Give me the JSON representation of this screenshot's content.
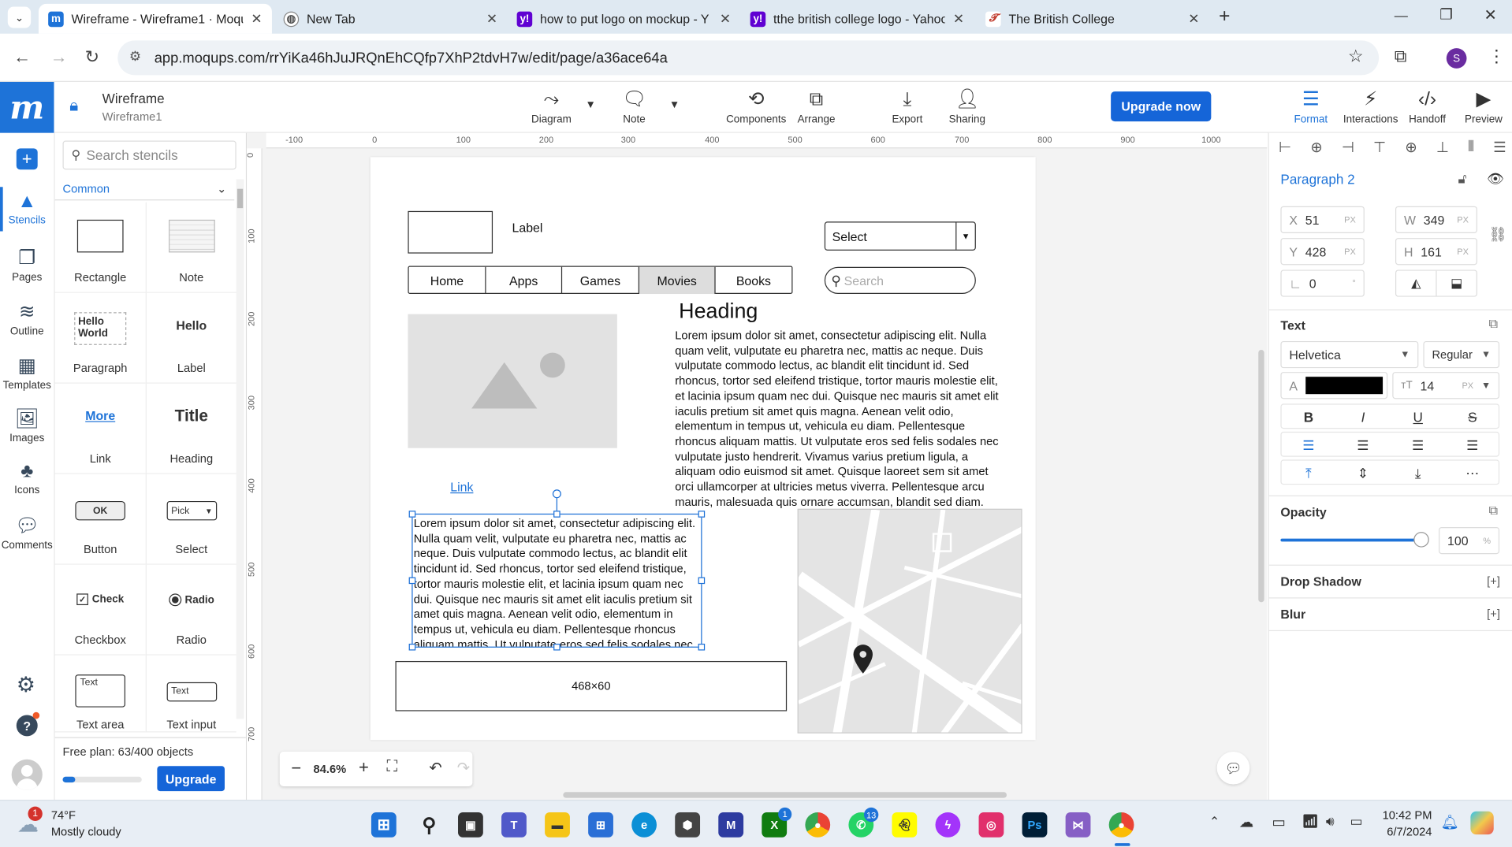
{
  "browser": {
    "tabs": [
      {
        "title": "Wireframe - Wireframe1 · Moqu",
        "active": true
      },
      {
        "title": "New Tab"
      },
      {
        "title": "how to put logo on mockup - Y"
      },
      {
        "title": "tthe british college logo - Yahoo"
      },
      {
        "title": "The British College"
      }
    ],
    "url": "app.moqups.com/rrYiKa46hJuJRQnEhCQfp7XhP2tdvH7w/edit/page/a36ace64a",
    "profile_initial": "S"
  },
  "app": {
    "logo": "m",
    "doc_title": "Wireframe",
    "doc_subtitle": "Wireframe1",
    "toolbar": [
      "Diagram",
      "Note",
      "Components",
      "Arrange",
      "Export",
      "Sharing"
    ],
    "upgrade_now": "Upgrade now",
    "right_tools": [
      "Format",
      "Interactions",
      "Handoff",
      "Preview"
    ]
  },
  "rail": [
    "Stencils",
    "Pages",
    "Outline",
    "Templates",
    "Images",
    "Icons",
    "Comments"
  ],
  "stencils": {
    "search_placeholder": "Search stencils",
    "category": "Common",
    "items": [
      "Rectangle",
      "Note",
      "Paragraph",
      "Label",
      "Link",
      "Heading",
      "Button",
      "Select",
      "Checkbox",
      "Radio",
      "Text area",
      "Text input"
    ],
    "preview_text": {
      "paragraph": "Hello World",
      "label": "Hello",
      "link": "More",
      "heading": "Title",
      "button": "OK",
      "select": "Pick",
      "checkbox": "Check",
      "radio": "Radio",
      "textarea": "Text",
      "textinput": "Text"
    },
    "plan_text": "Free plan: 63/400 objects",
    "plan_fraction": 0.1575,
    "upgrade": "Upgrade"
  },
  "ruler": {
    "h": [
      "-100",
      "0",
      "100",
      "200",
      "300",
      "400",
      "500",
      "600",
      "700",
      "800",
      "900",
      "1000"
    ],
    "v": [
      "0",
      "100",
      "200",
      "300",
      "400",
      "500",
      "600",
      "700"
    ]
  },
  "canvas": {
    "label": "Label",
    "select": "Select",
    "nav": [
      "Home",
      "Apps",
      "Games",
      "Movies",
      "Books"
    ],
    "search_placeholder": "Search",
    "heading": "Heading",
    "link": "Link",
    "paragraph_right": "Lorem ipsum dolor sit amet, consectetur adipiscing elit. Nulla quam velit, vulputate eu pharetra nec, mattis ac neque. Duis vulputate commodo lectus, ac blandit elit tincidunt id. Sed rhoncus, tortor sed eleifend tristique, tortor mauris molestie elit, et lacinia ipsum quam nec dui. Quisque nec mauris sit amet elit iaculis pretium sit amet quis magna. Aenean velit odio, elementum in tempus ut, vehicula eu diam. Pellentesque rhoncus aliquam mattis. Ut vulputate eros sed felis sodales nec vulputate justo hendrerit. Vivamus varius pretium ligula, a aliquam odio euismod sit amet. Quisque laoreet sem sit amet orci ullamcorper at ultricies metus viverra. Pellentesque arcu mauris, malesuada quis ornare accumsan, blandit sed diam.",
    "paragraph_left": "Lorem ipsum dolor sit amet, consectetur adipiscing elit. Nulla quam velit, vulputate eu pharetra nec, mattis ac neque. Duis vulputate commodo lectus, ac blandit elit tincidunt id. Sed rhoncus, tortor sed eleifend tristique, tortor mauris molestie elit, et lacinia ipsum quam nec dui. Quisque nec mauris sit amet elit iaculis pretium sit amet quis magna. Aenean velit odio, elementum in tempus ut, vehicula eu diam. Pellentesque rhoncus aliquam mattis. Ut vulputate eros sed felis sodales nec",
    "banner": "468×60",
    "zoom": "84.6%"
  },
  "format": {
    "element_name": "Paragraph 2",
    "x": "51",
    "y": "428",
    "w": "349",
    "h": "161",
    "rotation": "0",
    "px": "PX",
    "text_section": "Text",
    "font": "Helvetica",
    "weight": "Regular",
    "text_color": "#000000",
    "font_size": "14",
    "opacity_section": "Opacity",
    "opacity": "100",
    "percent": "%",
    "drop_shadow": "Drop Shadow",
    "blur": "Blur",
    "add": "[+]"
  },
  "taskbar": {
    "weather_temp": "74°F",
    "weather_desc": "Mostly cloudy",
    "weather_badge": "1",
    "time": "10:42 PM",
    "date": "6/7/2024",
    "badges": {
      "store": "1",
      "whatsapp": "13"
    }
  },
  "colors": {
    "accent": "#1565d8",
    "logo_bg": "#1e73d8",
    "selection": "#1b6fd6"
  }
}
